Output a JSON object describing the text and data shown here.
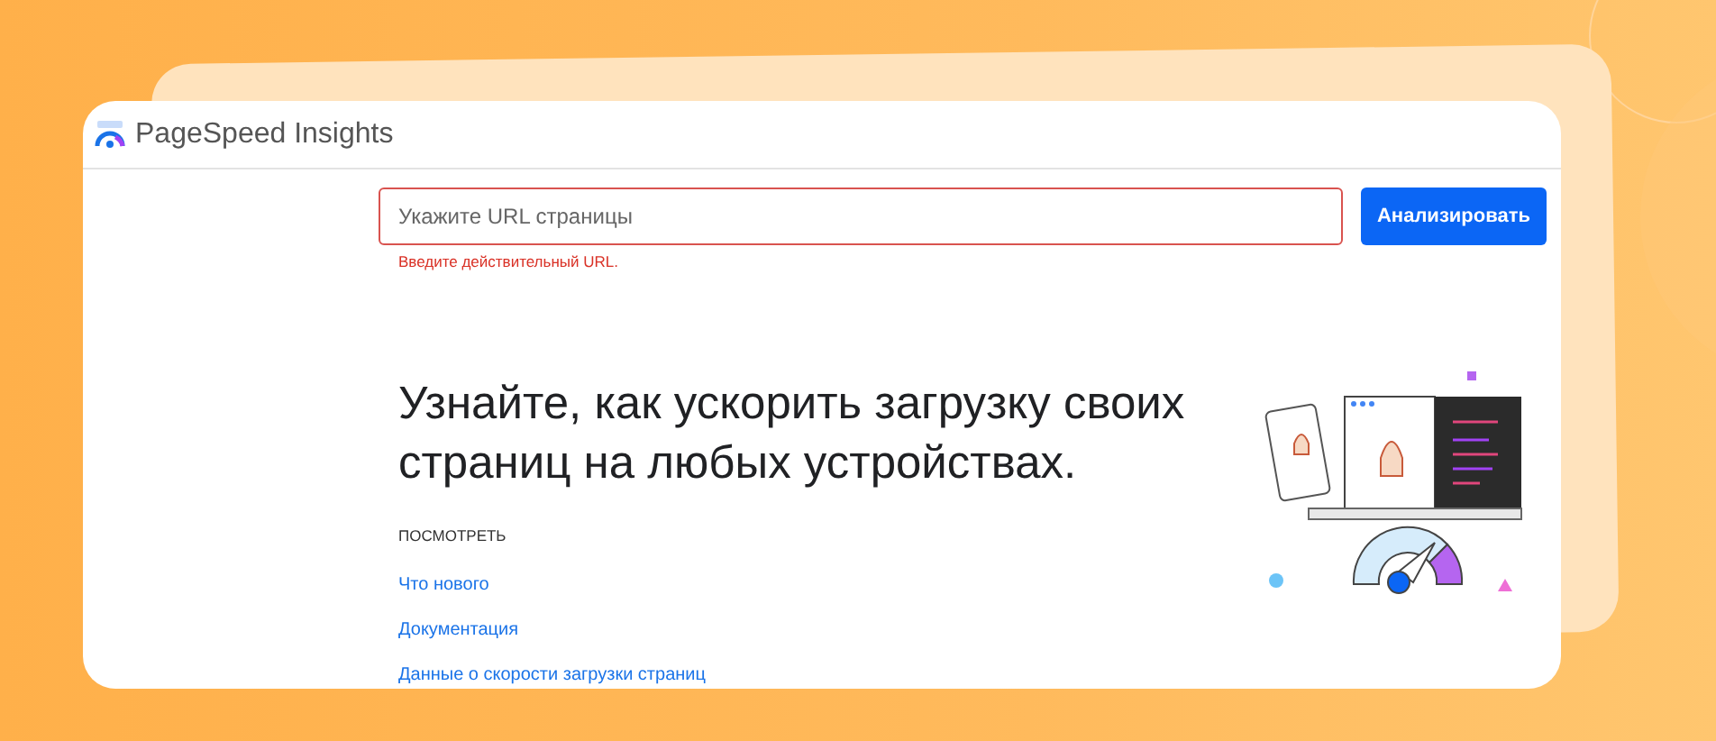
{
  "header": {
    "title": "PageSpeed Insights"
  },
  "search": {
    "placeholder": "Укажите URL страницы",
    "invalid": true,
    "error": "Введите действительный URL."
  },
  "analyze_button": {
    "label": "Анализировать"
  },
  "headline": "Узнайте, как ускорить загрузку своих страниц на любых устройствах.",
  "links_section": {
    "heading": "ПОСМОТРЕТЬ",
    "links": [
      "Что нового",
      "Документация",
      "Данные о скорости загрузки страниц"
    ]
  }
}
